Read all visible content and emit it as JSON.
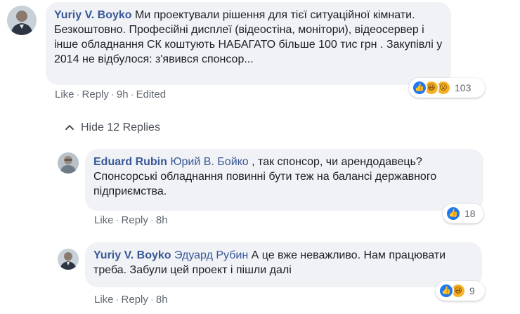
{
  "comments": [
    {
      "author": "Yuriy V. Boyko",
      "mention": "",
      "text": "Ми проектували рішення для тієї ситуаційної кімнати. Безкоштовно. Професійні дисплеї (відеостіна, монітори), відеосервер і інше обладнання СК коштують НАБАГАТО більше 100 тис грн . Закупівлі у 2014 не відбулося: з'явився спонсор...",
      "like_label": "Like",
      "reply_label": "Reply",
      "time": "9h",
      "edited_label": "Edited",
      "reaction_count": "103",
      "reactions": [
        "like-icon",
        "haha-icon",
        "wow-icon"
      ]
    }
  ],
  "toggle": {
    "label": "Hide 12 Replies",
    "icon": "chevron-up-icon"
  },
  "replies": [
    {
      "author": "Eduard Rubin",
      "mention": "Юрий В. Бойко",
      "text": ", так спонсор, чи арендодавець? Спонсорські обладнання повинні бути теж на балансі державного підприємства.",
      "like_label": "Like",
      "reply_label": "Reply",
      "time": "8h",
      "reaction_count": "18",
      "reactions": [
        "like-icon"
      ]
    },
    {
      "author": "Yuriy V. Boyko",
      "mention": "Эдуард Рубин",
      "text": "А це вже неважливо. Нам працювати треба. Забули цей проект і пішли далі",
      "like_label": "Like",
      "reply_label": "Reply",
      "time": "8h",
      "reaction_count": "9",
      "reactions": [
        "like-icon",
        "haha-icon"
      ]
    }
  ],
  "colors": {
    "author": "#385898",
    "bubble": "#f0f2f5",
    "like": "#2078f4",
    "emoji": "#f7b125",
    "meta": "#606770"
  }
}
